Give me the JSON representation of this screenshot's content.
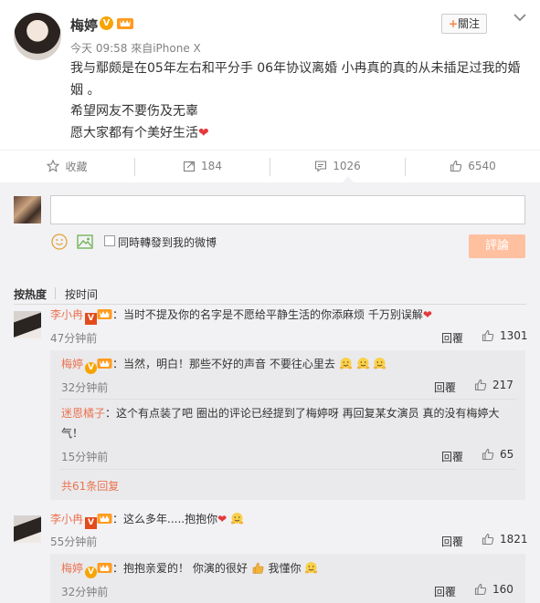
{
  "post": {
    "username": "梅婷",
    "follow_label": "關注",
    "time_source": "今天 09:58 來自iPhone X",
    "lines": [
      "我与鄢颇是在05年左右和平分手  06年协议离婚 小冉真的真的从未插足过我的婚姻 。",
      "希望网友不要伤及无辜",
      "愿大家都有个美好生活"
    ]
  },
  "actions": {
    "favorite_label": "收藏",
    "forward_count": "184",
    "comment_count": "1026",
    "like_count": "6540"
  },
  "composer": {
    "forward_label": "同時轉發到我的微博",
    "submit_label": "評論"
  },
  "sort": {
    "hot_label": "按热度",
    "time_label": "按时间"
  },
  "comments": [
    {
      "name": "李小冉",
      "text": "：当时不提及你的名字是不愿给平静生活的你添麻烦 千万别误解",
      "time": "47分钟前",
      "reply_label": "回覆",
      "likes": "1301",
      "replies": [
        {
          "name": "梅婷",
          "text": "：当然，明白！那些不好的声音 不要往心里去",
          "time": "32分钟前",
          "reply_label": "回覆",
          "likes": "217"
        },
        {
          "name": "迷恩橘子",
          "text": "：这个有点装了吧 圈出的评论已经提到了梅婷呀 再回复某女演员 真的没有梅婷大气！",
          "time": "15分钟前",
          "reply_label": "回覆",
          "likes": "65"
        }
      ],
      "more_replies": "共61条回复"
    },
    {
      "name": "李小冉",
      "text": "：这么多年.....抱抱你",
      "time": "55分钟前",
      "reply_label": "回覆",
      "likes": "1821",
      "replies": [
        {
          "name": "梅婷",
          "text": "：抱抱亲爱的！ 你演的很好",
          "text2": " 我懂你",
          "time": "32分钟前",
          "reply_label": "回覆",
          "likes": "160"
        }
      ]
    }
  ],
  "colors": {
    "accent_orange": "#eb7350",
    "submit_disabled": "#ffc09f",
    "verified_gold": "#f7a400"
  }
}
